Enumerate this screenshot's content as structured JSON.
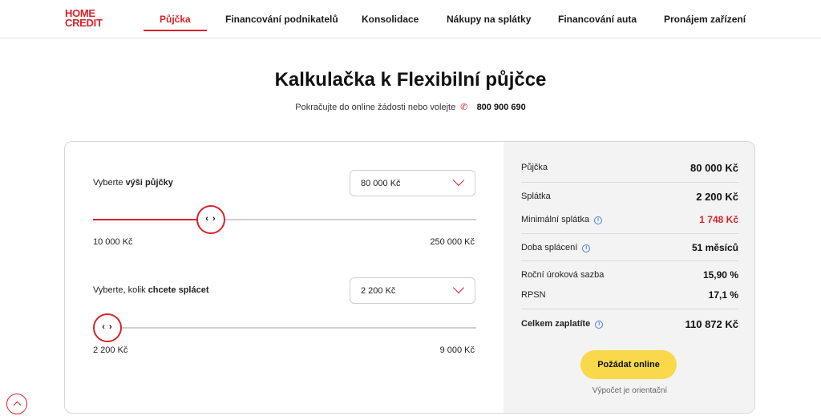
{
  "brand": {
    "line1": "HOME",
    "line2": "CREDIT",
    "color": "#d8232a"
  },
  "nav": {
    "items": [
      {
        "label": "Půjčka",
        "active": true
      },
      {
        "label": "Financování podnikatelů"
      },
      {
        "label": "Konsolidace"
      },
      {
        "label": "Nákupy na splátky"
      },
      {
        "label": "Financování auta"
      },
      {
        "label": "Pronájem zařízení"
      }
    ]
  },
  "page": {
    "title": "Kalkulačka k Flexibilní půjčce",
    "subtitle": "Pokračujte do online žádosti nebo volejte",
    "phone": "800 900 690",
    "phone_icon": "phone-icon"
  },
  "calculator": {
    "amount": {
      "label_prefix": "Vyberte ",
      "label_bold": "výši půjčky",
      "selected": "80 000 Kč",
      "min_label": "10 000 Kč",
      "max_label": "250 000 Kč",
      "slider_fraction": 0.2917
    },
    "payment": {
      "label_prefix": "Vyberte, kolik ",
      "label_bold": "chcete splácet",
      "selected": "2 200 Kč",
      "min_label": "2 200 Kč",
      "max_label": "9 000 Kč",
      "slider_fraction": 0
    },
    "thumb_glyph": "‹ ›"
  },
  "summary": {
    "loan_label": "Půjčka",
    "loan_value": "80 000 Kč",
    "installment_label": "Splátka",
    "installment_value": "2 200 Kč",
    "min_installment_label": "Minimální splátka",
    "min_installment_value": "1 748 Kč",
    "duration_label": "Doba splácení",
    "duration_value": "51 měsíců",
    "rate_label": "Roční úroková sazba",
    "rate_value": "15,90 %",
    "rpsn_label": "RPSN",
    "rpsn_value": "17,1 %",
    "total_label": "Celkem zaplatíte",
    "total_value": "110 872 Kč",
    "info_icon": "i",
    "apply_label": "Požádat online",
    "note": "Výpočet je orientační"
  },
  "colors": {
    "accent": "#d8232a",
    "button": "#f9d84a",
    "panel": "#f3f3f3"
  }
}
